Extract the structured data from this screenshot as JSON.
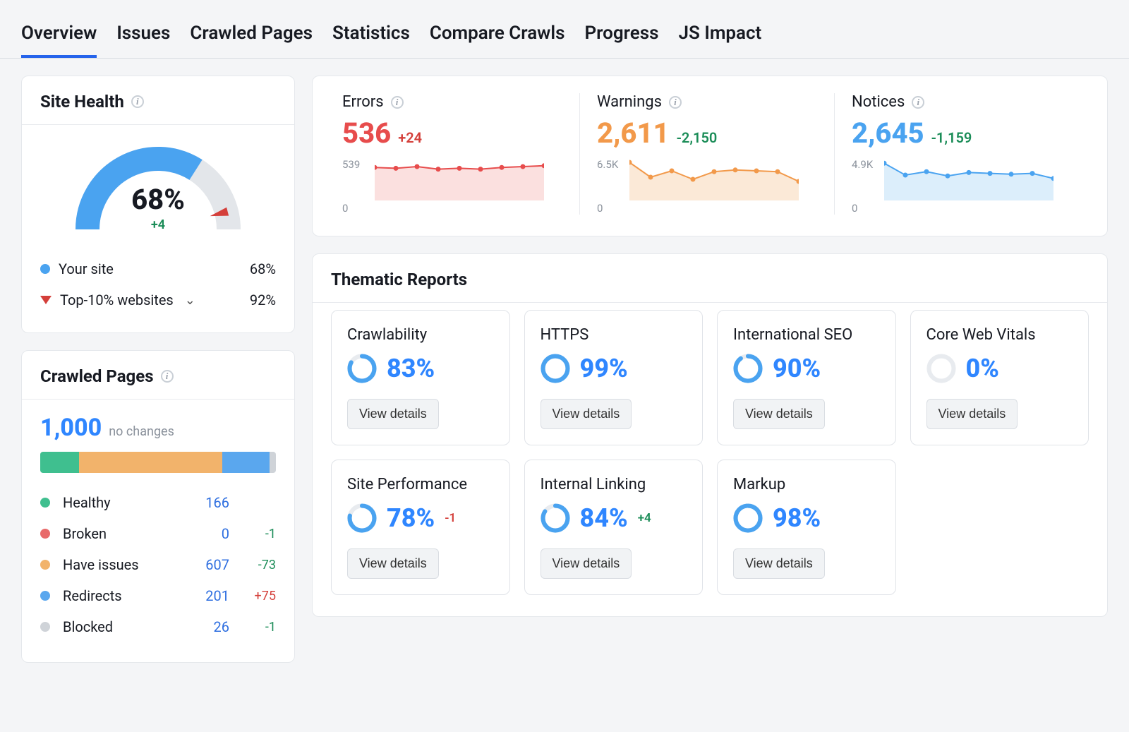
{
  "tabs": [
    "Overview",
    "Issues",
    "Crawled Pages",
    "Statistics",
    "Compare Crawls",
    "Progress",
    "JS Impact"
  ],
  "active_tab": 0,
  "site_health": {
    "title": "Site Health",
    "percent_text": "68%",
    "percent": 68,
    "delta": "+4",
    "your_site_label": "Your site",
    "your_site_value": "68%",
    "top10_label": "Top-10% websites",
    "top10_value": "92%"
  },
  "crawled_pages": {
    "title": "Crawled Pages",
    "total": "1,000",
    "note": "no changes",
    "segments": [
      {
        "label": "Healthy",
        "value": "166",
        "delta": "",
        "color": "#3fbf8f"
      },
      {
        "label": "Broken",
        "value": "0",
        "delta": "-1",
        "color": "#e86a6a"
      },
      {
        "label": "Have issues",
        "value": "607",
        "delta": "-73",
        "color": "#f2b36b"
      },
      {
        "label": "Redirects",
        "value": "201",
        "delta": "+75",
        "color": "#5aa7ee"
      },
      {
        "label": "Blocked",
        "value": "26",
        "delta": "-1",
        "color": "#cfd3d8"
      }
    ]
  },
  "issues": {
    "errors": {
      "title": "Errors",
      "value": "536",
      "delta": "+24",
      "delta_cls": "red",
      "y_top": "539",
      "y_bot": "0",
      "color": "#e74c4c",
      "fill": "#fbe0df",
      "points": [
        0.78,
        0.76,
        0.8,
        0.74,
        0.76,
        0.74,
        0.78,
        0.8,
        0.82
      ]
    },
    "warnings": {
      "title": "Warnings",
      "value": "2,611",
      "delta": "-2,150",
      "delta_cls": "green",
      "y_top": "6.5K",
      "y_bot": "0",
      "color": "#f2994a",
      "fill": "#fbe9d7",
      "points": [
        0.9,
        0.55,
        0.7,
        0.5,
        0.68,
        0.72,
        0.7,
        0.68,
        0.45
      ]
    },
    "notices": {
      "title": "Notices",
      "value": "2,645",
      "delta": "-1,159",
      "delta_cls": "green",
      "y_top": "4.9K",
      "y_bot": "0",
      "color": "#4aa3f0",
      "fill": "#dceefb",
      "points": [
        0.88,
        0.6,
        0.68,
        0.58,
        0.66,
        0.64,
        0.62,
        0.64,
        0.52
      ]
    }
  },
  "thematic": {
    "title": "Thematic Reports",
    "btn": "View details",
    "cards": [
      {
        "title": "Crawlability",
        "pct": 83,
        "pct_text": "83%",
        "delta": ""
      },
      {
        "title": "HTTPS",
        "pct": 99,
        "pct_text": "99%",
        "delta": ""
      },
      {
        "title": "International SEO",
        "pct": 90,
        "pct_text": "90%",
        "delta": ""
      },
      {
        "title": "Core Web Vitals",
        "pct": 0,
        "pct_text": "0%",
        "delta": ""
      },
      {
        "title": "Site Performance",
        "pct": 78,
        "pct_text": "78%",
        "delta": "-1",
        "delta_cls": "red"
      },
      {
        "title": "Internal Linking",
        "pct": 84,
        "pct_text": "84%",
        "delta": "+4",
        "delta_cls": "green"
      },
      {
        "title": "Markup",
        "pct": 98,
        "pct_text": "98%",
        "delta": ""
      }
    ]
  },
  "chart_data": [
    {
      "type": "area",
      "title": "Errors",
      "ylim": [
        0,
        539
      ],
      "y_ticks": [
        "0",
        "539"
      ],
      "values": [
        420,
        410,
        431,
        399,
        410,
        399,
        420,
        431,
        442
      ]
    },
    {
      "type": "area",
      "title": "Warnings",
      "ylim": [
        0,
        6500
      ],
      "y_ticks": [
        "0",
        "6.5K"
      ],
      "values": [
        5850,
        3575,
        4550,
        3250,
        4420,
        4680,
        4550,
        4420,
        2925
      ]
    },
    {
      "type": "area",
      "title": "Notices",
      "ylim": [
        0,
        4900
      ],
      "y_ticks": [
        "0",
        "4.9K"
      ],
      "values": [
        4312,
        2940,
        3332,
        2842,
        3234,
        3136,
        3038,
        3136,
        2548
      ]
    }
  ]
}
